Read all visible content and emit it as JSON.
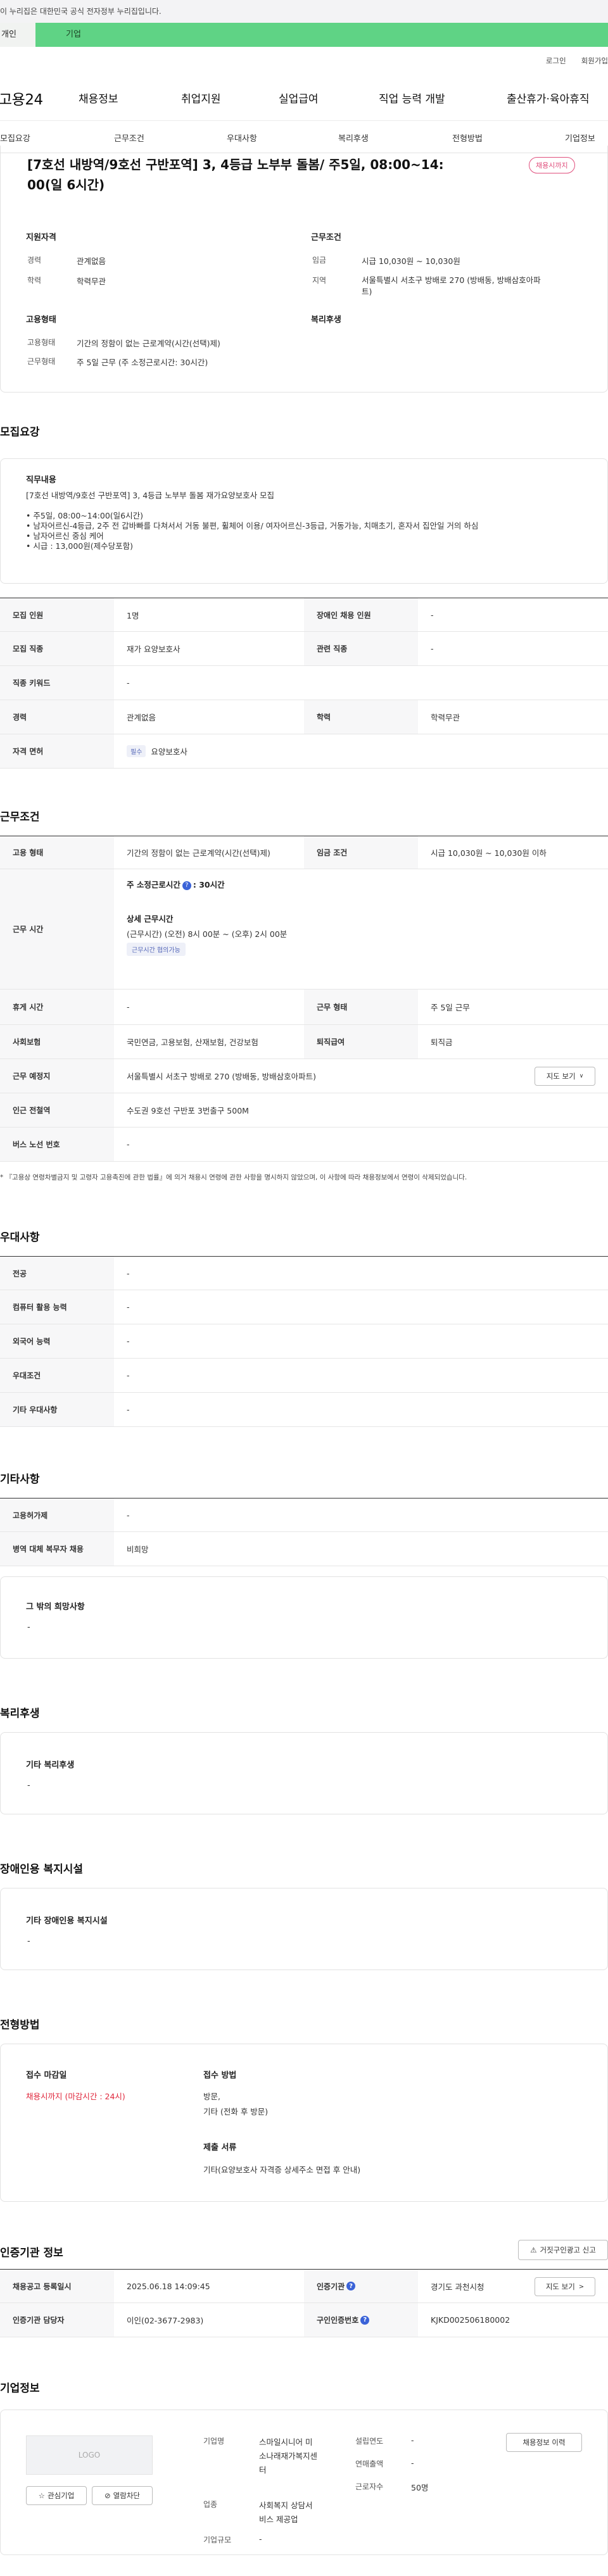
{
  "gov_banner": "이 누리집은 대한민국 공식 전자정부 누리집입니다.",
  "user_tabs": {
    "person": "개인",
    "business": "기업"
  },
  "utility": {
    "login": "로그인",
    "signup": "회원가입"
  },
  "brand": "고용24",
  "gnb": [
    "채용정보",
    "취업지원",
    "실업급여",
    "직업 능력 개발",
    "출산휴가·육아휴직"
  ],
  "subnav": [
    "모집요강",
    "근무조건",
    "우대사항",
    "복리후생",
    "전형방법",
    "기업정보"
  ],
  "summary": {
    "title_line1": "[7호선 내방역/9호선 구반포역] 3, 4등급 노부부 돌봄/ 주5일, 08:00~14:",
    "title_line2": "00(일 6시간)",
    "status_badge": "채용시까지",
    "qual_heading": "지원자격",
    "qual": [
      {
        "label": "경력",
        "value": "관계없음"
      },
      {
        "label": "학력",
        "value": "학력무관"
      }
    ],
    "cond_heading": "근무조건",
    "cond": [
      {
        "label": "임금",
        "value": "시급 10,030원 ~ 10,030원"
      },
      {
        "label": "지역",
        "value": "서울특별시 서초구 방배로 270 (방배동, 방배삼호아파",
        "value2": "트)"
      }
    ],
    "emp_heading": "고용형태",
    "emp": [
      {
        "label": "고용형태",
        "value": "기간의 정함이 없는 근로계약(시간(선택)제)"
      },
      {
        "label": "근무형태",
        "value": "주 5일 근무 (주 소정근로시간: 30시간)"
      }
    ],
    "welfare_heading": "복리후생"
  },
  "recruit": {
    "heading": "모집요강",
    "duty_heading": "직무내용",
    "duty_lines": [
      "[7호선 내방역/9호선 구반포역] 3, 4등급 노부부 돌봄 재가요양보호사 모집",
      "",
      "• 주5일, 08:00~14:00(일6시간)",
      "• 남자어르신-4등급, 2주 전 갑바빠를 다쳐서서 거동 불편, 휠체어 이용/ 여자어르신-3등급, 거동가능, 치매초기, 혼자서 집안일 거의 하심",
      "• 남자어르신 중심 케어",
      "• 시급 : 13,000원(제수당포함)"
    ],
    "rows": [
      {
        "l1": "모집 인원",
        "v1": "1명",
        "l2": "장애인 채용 인원",
        "v2": "-"
      },
      {
        "l1": "모집 직종",
        "v1": "재가 요양보호사",
        "l2": "관련 직종",
        "v2": "-"
      },
      {
        "l1": "직종 키워드",
        "v1": "-"
      },
      {
        "l1": "경력",
        "v1": "관계없음",
        "l2": "학력",
        "v2": "학력무관"
      },
      {
        "l1": "자격 면허",
        "chip": "필수",
        "v1": "요양보호사"
      }
    ]
  },
  "work": {
    "heading": "근무조건",
    "emp_type_label": "고용 형태",
    "emp_type": "기간의 정함이 없는 근로계약(시간(선택)제)",
    "wage_label": "임금 조건",
    "wage": "시급 10,030원 ~ 10,030원 이하",
    "hours_label": "근무 시간",
    "hours_total_label": "주 소정근로시간",
    "hours_total": ": 30시간",
    "hours_detail_label": "상세 근무시간",
    "hours_detail": "(근무시간) (오전) 8시 00분 ~ (오후) 2시 00분",
    "hours_chip": "근무시간 협의가능",
    "rest_label": "휴게 시간",
    "rest": "-",
    "shift_label": "근무 형태",
    "shift": "주 5일 근무",
    "insurance_label": "사회보험",
    "insurance": "국민연금, 고용보험, 산재보험, 건강보험",
    "severance_label": "퇴직급여",
    "severance": "퇴직금",
    "place_label": "근무 예정지",
    "place": "서울특별시 서초구 방배로 270 (방배동, 방배삼호아파트)",
    "map_btn": "지도 보기",
    "subway_label": "인근 전철역",
    "subway": "수도권 9호선 구반포 3번출구 500M",
    "bus_label": "버스 노선 번호",
    "bus": "-",
    "note": "* 『고용상 연령차별금지 및 고령자 고용촉진에 관한 법률』에 의거 채용시 연령에 관한 사항을 명시하지 않았으며, 이 사항에 따라 채용정보에서 연령이 삭제되었습니다."
  },
  "prefer": {
    "heading": "우대사항",
    "rows": [
      {
        "label": "전공",
        "value": "-"
      },
      {
        "label": "컴퓨터 활용 능력",
        "value": "-"
      },
      {
        "label": "외국어 능력",
        "value": "-"
      },
      {
        "label": "우대조건",
        "value": "-"
      },
      {
        "label": "기타 우대사항",
        "value": "-"
      }
    ]
  },
  "etc": {
    "heading": "기타사항",
    "rows": [
      {
        "label": "고용허가제",
        "value": "-"
      },
      {
        "label": "병역 대체 복무자 채용",
        "value": "비희망"
      }
    ],
    "other_heading": "그 밖의 희망사항",
    "other": "-"
  },
  "welfare": {
    "heading": "복리후생",
    "sub": "기타 복리후생",
    "value": "-"
  },
  "disabled": {
    "heading": "장애인용 복지시설",
    "sub": "기타 장애인용 복지시설",
    "value": "-"
  },
  "screening": {
    "heading": "전형방법",
    "deadline_label": "접수 마감일",
    "deadline": "채용시까지 (마감시간 : 24시)",
    "method_label": "접수 방법",
    "method1": "방문,",
    "method2": "기타 (전화 후 방문)",
    "docs_label": "제출 서류",
    "docs": "기타(요양보호사 자격증 상세주소 면접 후 안내)"
  },
  "cert": {
    "heading": "인증기관 정보",
    "report_btn": "거짓구인광고 신고",
    "reg_label": "채용공고 등록일시",
    "reg": "2025.06.18 14:09:45",
    "agency_label": "인증기관",
    "agency": "경기도 과천시청",
    "map_btn": "지도 보기",
    "manager_label": "인증기관 담당자",
    "manager": "이인(02-3677-2983)",
    "number_label": "구인인증번호",
    "number": "KJKD002506180002"
  },
  "company": {
    "heading": "기업정보",
    "logo_text": "LOGO",
    "fav_btn": "관심기업",
    "block_btn": "열람차단",
    "name_label": "기업명",
    "name_lines": [
      "스마일시니어 미",
      "소나래재가복지센",
      "터"
    ],
    "industry_label": "업종",
    "industry_lines": [
      "사회복지 상담서",
      "비스 제공업"
    ],
    "size_label": "기업규모",
    "size": "-",
    "founded_label": "설립연도",
    "founded": "-",
    "sales_label": "연매출액",
    "sales": "-",
    "employees_label": "근로자수",
    "employees": "50명",
    "jobs_btn": "채용정보 이력"
  },
  "colors": {
    "green": "#5fd385",
    "pink": "#e04f7d",
    "red": "#e0283d",
    "blue": "#3b63d8"
  }
}
